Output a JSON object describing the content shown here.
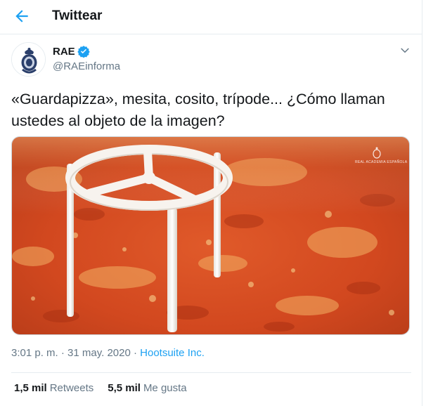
{
  "header": {
    "title": "Twittear",
    "back_icon": "arrow-left-icon"
  },
  "author": {
    "name": "RAE",
    "handle": "@RAEinforma",
    "verified_icon": "verified-badge-icon",
    "avatar_icon": "rae-crest-icon"
  },
  "tweet": {
    "text": "«Guardapizza», mesita, cosito, trípode... ¿Cómo llaman ustedes al objeto de la imagen?",
    "image": {
      "description_icon": "pizza-saver-photo",
      "watermark": "REAL ACADEMIA ESPAÑOLA"
    },
    "time": "3:01 p. m. · 31 may. 2020",
    "separator": " · ",
    "source": "Hootsuite Inc."
  },
  "stats": {
    "retweets_count": "1,5 mil",
    "retweets_label": "Retweets",
    "likes_count": "5,5 mil",
    "likes_label": "Me gusta"
  },
  "colors": {
    "accent": "#1da1f2",
    "secondary_text": "#657786",
    "border": "#e6ecf0"
  }
}
